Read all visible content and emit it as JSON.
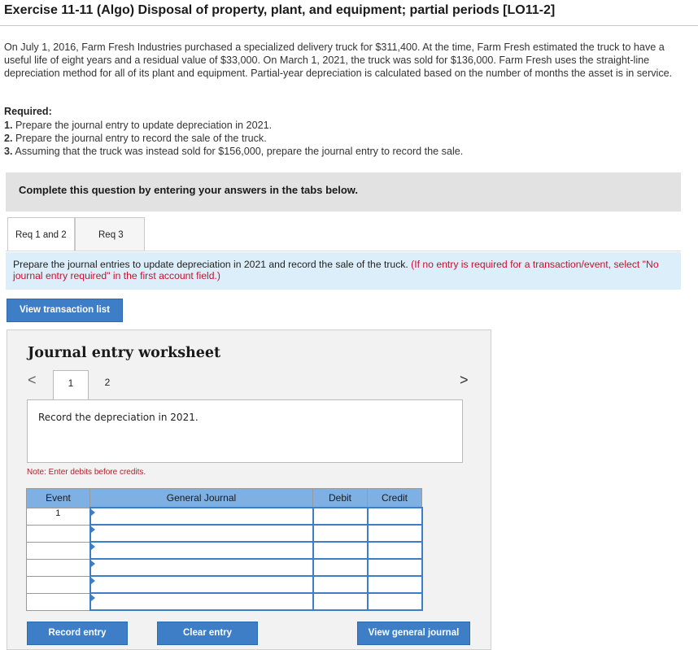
{
  "page": {
    "title": "Exercise 11-11 (Algo) Disposal of property, plant, and equipment; partial periods [LO11-2]",
    "problem_text": "On July 1, 2016, Farm Fresh Industries purchased a specialized delivery truck for $311,400. At the time, Farm Fresh estimated the truck to have a useful life of eight years and a residual value of $33,000. On March 1, 2021, the truck was sold for $136,000. Farm Fresh uses the straight-line depreciation method for all of its plant and equipment. Partial-year depreciation is calculated based on the number of months the asset is in service.",
    "required_label": "Required:",
    "requirements": [
      {
        "num": "1.",
        "text": "Prepare the journal entry to update depreciation in 2021."
      },
      {
        "num": "2.",
        "text": "Prepare the journal entry to record the sale of the truck."
      },
      {
        "num": "3.",
        "text": "Assuming that the truck was instead sold for $156,000, prepare the journal entry to record the sale."
      }
    ]
  },
  "banner": {
    "text": "Complete this question by entering your answers in the tabs below."
  },
  "tabs": [
    {
      "label": "Req 1 and 2",
      "active": true
    },
    {
      "label": "Req 3",
      "active": false
    }
  ],
  "instruction": {
    "main": "Prepare the journal entries to update depreciation in 2021 and record the sale of the truck.",
    "note": "(If no entry is required for a transaction/event, select \"No journal entry required\" in the first account field.)"
  },
  "buttons": {
    "view_transaction_list": "View transaction list",
    "record_entry": "Record entry",
    "clear_entry": "Clear entry",
    "view_general_journal": "View general journal"
  },
  "worksheet": {
    "title": "Journal entry worksheet",
    "nav_prev": "<",
    "nav_next": ">",
    "pages": [
      "1",
      "2"
    ],
    "current_page": "1",
    "record_prompt": "Record the depreciation in 2021.",
    "note": "Note: Enter debits before credits."
  },
  "journal": {
    "headers": [
      "Event",
      "General Journal",
      "Debit",
      "Credit"
    ],
    "rows": [
      {
        "event": "1",
        "account": "",
        "debit": "",
        "credit": ""
      },
      {
        "event": "",
        "account": "",
        "debit": "",
        "credit": ""
      },
      {
        "event": "",
        "account": "",
        "debit": "",
        "credit": ""
      },
      {
        "event": "",
        "account": "",
        "debit": "",
        "credit": ""
      },
      {
        "event": "",
        "account": "",
        "debit": "",
        "credit": ""
      },
      {
        "event": "",
        "account": "",
        "debit": "",
        "credit": ""
      }
    ]
  },
  "colors": {
    "button_blue": "#3e7ec6",
    "header_blue": "#7fb0e3",
    "instruction_bg": "#dceefa",
    "note_red": "#c8102e"
  }
}
